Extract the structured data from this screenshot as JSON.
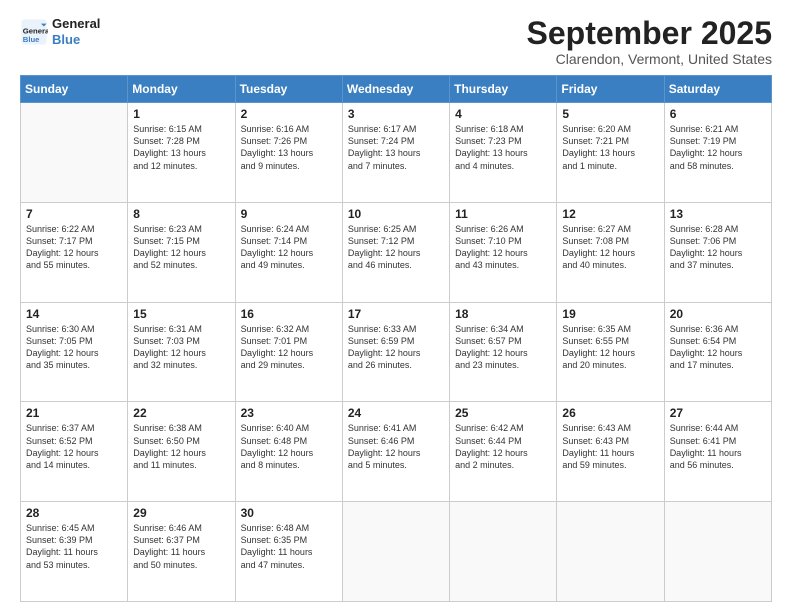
{
  "header": {
    "logo_line1": "General",
    "logo_line2": "Blue",
    "title": "September 2025",
    "subtitle": "Clarendon, Vermont, United States"
  },
  "weekdays": [
    "Sunday",
    "Monday",
    "Tuesday",
    "Wednesday",
    "Thursday",
    "Friday",
    "Saturday"
  ],
  "weeks": [
    [
      {
        "day": "",
        "info": ""
      },
      {
        "day": "1",
        "info": "Sunrise: 6:15 AM\nSunset: 7:28 PM\nDaylight: 13 hours\nand 12 minutes."
      },
      {
        "day": "2",
        "info": "Sunrise: 6:16 AM\nSunset: 7:26 PM\nDaylight: 13 hours\nand 9 minutes."
      },
      {
        "day": "3",
        "info": "Sunrise: 6:17 AM\nSunset: 7:24 PM\nDaylight: 13 hours\nand 7 minutes."
      },
      {
        "day": "4",
        "info": "Sunrise: 6:18 AM\nSunset: 7:23 PM\nDaylight: 13 hours\nand 4 minutes."
      },
      {
        "day": "5",
        "info": "Sunrise: 6:20 AM\nSunset: 7:21 PM\nDaylight: 13 hours\nand 1 minute."
      },
      {
        "day": "6",
        "info": "Sunrise: 6:21 AM\nSunset: 7:19 PM\nDaylight: 12 hours\nand 58 minutes."
      }
    ],
    [
      {
        "day": "7",
        "info": "Sunrise: 6:22 AM\nSunset: 7:17 PM\nDaylight: 12 hours\nand 55 minutes."
      },
      {
        "day": "8",
        "info": "Sunrise: 6:23 AM\nSunset: 7:15 PM\nDaylight: 12 hours\nand 52 minutes."
      },
      {
        "day": "9",
        "info": "Sunrise: 6:24 AM\nSunset: 7:14 PM\nDaylight: 12 hours\nand 49 minutes."
      },
      {
        "day": "10",
        "info": "Sunrise: 6:25 AM\nSunset: 7:12 PM\nDaylight: 12 hours\nand 46 minutes."
      },
      {
        "day": "11",
        "info": "Sunrise: 6:26 AM\nSunset: 7:10 PM\nDaylight: 12 hours\nand 43 minutes."
      },
      {
        "day": "12",
        "info": "Sunrise: 6:27 AM\nSunset: 7:08 PM\nDaylight: 12 hours\nand 40 minutes."
      },
      {
        "day": "13",
        "info": "Sunrise: 6:28 AM\nSunset: 7:06 PM\nDaylight: 12 hours\nand 37 minutes."
      }
    ],
    [
      {
        "day": "14",
        "info": "Sunrise: 6:30 AM\nSunset: 7:05 PM\nDaylight: 12 hours\nand 35 minutes."
      },
      {
        "day": "15",
        "info": "Sunrise: 6:31 AM\nSunset: 7:03 PM\nDaylight: 12 hours\nand 32 minutes."
      },
      {
        "day": "16",
        "info": "Sunrise: 6:32 AM\nSunset: 7:01 PM\nDaylight: 12 hours\nand 29 minutes."
      },
      {
        "day": "17",
        "info": "Sunrise: 6:33 AM\nSunset: 6:59 PM\nDaylight: 12 hours\nand 26 minutes."
      },
      {
        "day": "18",
        "info": "Sunrise: 6:34 AM\nSunset: 6:57 PM\nDaylight: 12 hours\nand 23 minutes."
      },
      {
        "day": "19",
        "info": "Sunrise: 6:35 AM\nSunset: 6:55 PM\nDaylight: 12 hours\nand 20 minutes."
      },
      {
        "day": "20",
        "info": "Sunrise: 6:36 AM\nSunset: 6:54 PM\nDaylight: 12 hours\nand 17 minutes."
      }
    ],
    [
      {
        "day": "21",
        "info": "Sunrise: 6:37 AM\nSunset: 6:52 PM\nDaylight: 12 hours\nand 14 minutes."
      },
      {
        "day": "22",
        "info": "Sunrise: 6:38 AM\nSunset: 6:50 PM\nDaylight: 12 hours\nand 11 minutes."
      },
      {
        "day": "23",
        "info": "Sunrise: 6:40 AM\nSunset: 6:48 PM\nDaylight: 12 hours\nand 8 minutes."
      },
      {
        "day": "24",
        "info": "Sunrise: 6:41 AM\nSunset: 6:46 PM\nDaylight: 12 hours\nand 5 minutes."
      },
      {
        "day": "25",
        "info": "Sunrise: 6:42 AM\nSunset: 6:44 PM\nDaylight: 12 hours\nand 2 minutes."
      },
      {
        "day": "26",
        "info": "Sunrise: 6:43 AM\nSunset: 6:43 PM\nDaylight: 11 hours\nand 59 minutes."
      },
      {
        "day": "27",
        "info": "Sunrise: 6:44 AM\nSunset: 6:41 PM\nDaylight: 11 hours\nand 56 minutes."
      }
    ],
    [
      {
        "day": "28",
        "info": "Sunrise: 6:45 AM\nSunset: 6:39 PM\nDaylight: 11 hours\nand 53 minutes."
      },
      {
        "day": "29",
        "info": "Sunrise: 6:46 AM\nSunset: 6:37 PM\nDaylight: 11 hours\nand 50 minutes."
      },
      {
        "day": "30",
        "info": "Sunrise: 6:48 AM\nSunset: 6:35 PM\nDaylight: 11 hours\nand 47 minutes."
      },
      {
        "day": "",
        "info": ""
      },
      {
        "day": "",
        "info": ""
      },
      {
        "day": "",
        "info": ""
      },
      {
        "day": "",
        "info": ""
      }
    ]
  ]
}
